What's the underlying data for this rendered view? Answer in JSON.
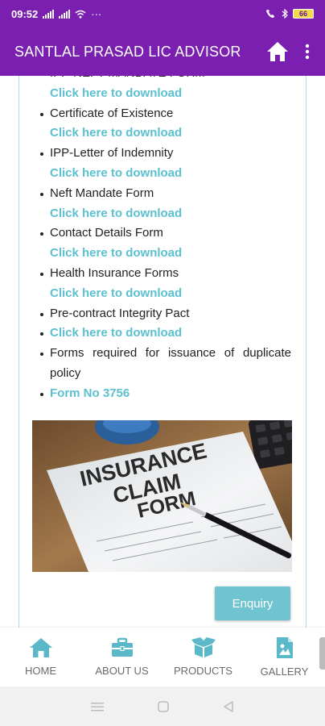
{
  "status_bar": {
    "time": "09:52",
    "more": "···",
    "network_icons": [
      "signal-icon",
      "signal-icon",
      "wifi-icon"
    ],
    "right_icons": [
      "volte-icon",
      "bluetooth-icon"
    ],
    "battery_level": "66"
  },
  "app_bar": {
    "title": "SANTLAL PRASAD LIC ADVISOR",
    "home_icon": "home-icon",
    "more_icon": "more-vert-icon",
    "color": "#7a1fb0"
  },
  "forms": {
    "partial_top_label": "IPP-NEFT MANDATE FORM",
    "download_text": "Click here to download",
    "items": [
      {
        "label": "Certificate of Existence",
        "link": "Click here to download"
      },
      {
        "label": "IPP-Letter of Indemnity",
        "link": "Click here to download"
      },
      {
        "label": "Neft Mandate Form",
        "link": "Click here to download"
      },
      {
        "label": "Contact Details Form",
        "link": "Click here to download"
      },
      {
        "label": "Health Insurance Forms",
        "link": "Click here to download"
      },
      {
        "label": "Pre-contract Integrity Pact",
        "link": "Click here to download"
      }
    ],
    "duplicate_policy_label": "Forms required for issuance of duplicate policy",
    "form_no_link": "Form No 3756",
    "link_color": "#5bc0d0"
  },
  "claim_image": {
    "line1": "INSURANCE",
    "line2": "CLAIM",
    "line3": "FORM"
  },
  "enquiry_button": "Enquiry",
  "bottom_nav": [
    {
      "label": "HOME",
      "icon": "home-icon"
    },
    {
      "label": "ABOUT US",
      "icon": "briefcase-icon"
    },
    {
      "label": "PRODUCTS",
      "icon": "box-icon"
    },
    {
      "label": "GALLERY",
      "icon": "image-file-icon"
    }
  ],
  "bottom_nav_icon_color": "#5bb8c8",
  "system_nav": [
    "menu-icon",
    "home-square-icon",
    "back-triangle-icon"
  ]
}
